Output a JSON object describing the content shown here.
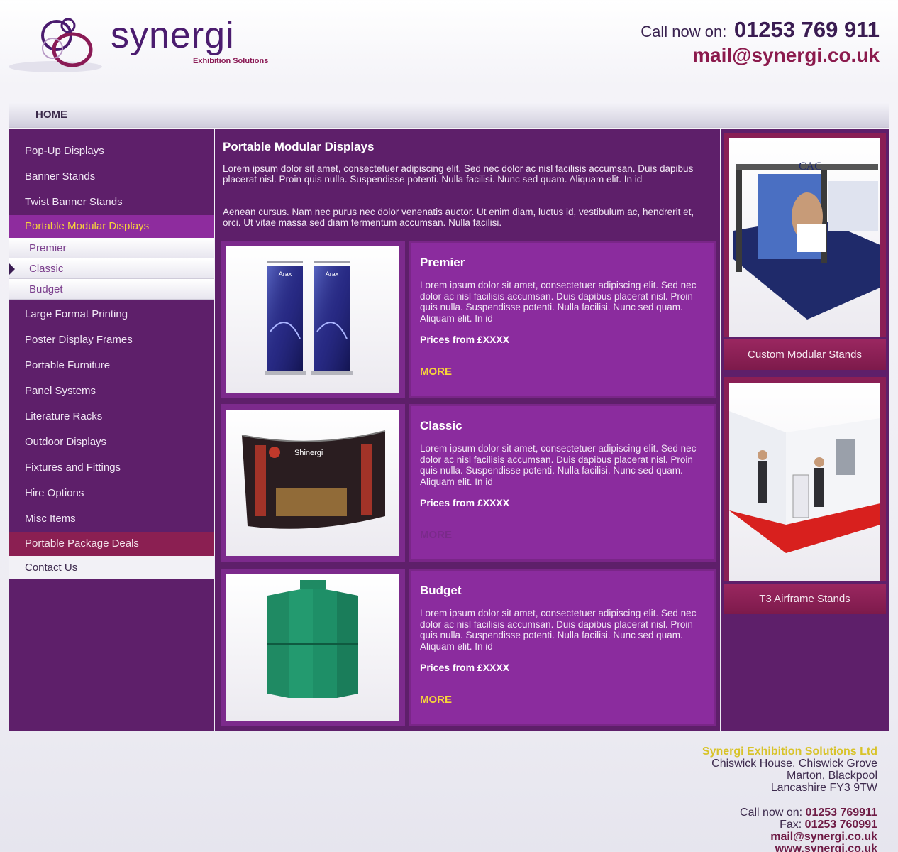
{
  "brand": {
    "logo_text": "synergi",
    "logo_sub": "Exhibition Solutions"
  },
  "header": {
    "call_label": "Call now on:",
    "phone": "01253 769 911",
    "email": "mail@synergi.co.uk"
  },
  "nav": {
    "home": "HOME"
  },
  "sidebar": {
    "items_top": [
      {
        "label": "Pop-Up Displays"
      },
      {
        "label": "Banner Stands"
      },
      {
        "label": "Twist Banner Stands"
      }
    ],
    "active": "Portable Modular Displays",
    "sub_items": [
      {
        "label": "Premier"
      },
      {
        "label": "Classic"
      },
      {
        "label": "Budget"
      }
    ],
    "items_bottom": [
      {
        "label": "Large Format Printing"
      },
      {
        "label": "Poster Display Frames"
      },
      {
        "label": "Portable Furniture"
      },
      {
        "label": "Panel Systems"
      },
      {
        "label": "Literature Racks"
      },
      {
        "label": "Outdoor Displays"
      },
      {
        "label": "Fixtures and Fittings"
      },
      {
        "label": "Hire Options"
      },
      {
        "label": "Misc Items"
      }
    ],
    "package": "Portable Package Deals",
    "contact": "Contact Us"
  },
  "main": {
    "title": "Portable Modular Displays",
    "p1": "Lorem ipsum dolor sit amet, consectetuer adipiscing elit. Sed nec dolor ac nisl facilisis accumsan. Duis dapibus placerat nisl. Proin quis nulla. Suspendisse potenti. Nulla facilisi. Nunc sed quam. Aliquam elit. In id",
    "p2": "Aenean cursus. Nam nec purus nec dolor venenatis auctor. Ut enim diam, luctus id, vestibulum ac, hendrerit et, orci. Ut vitae massa sed diam fermentum accumsan. Nulla facilisi.",
    "products": [
      {
        "title": "Premier",
        "desc": "Lorem ipsum dolor sit amet, consectetuer adipiscing elit. Sed nec dolor ac nisl facilisis accumsan. Duis dapibus placerat nisl. Proin quis nulla. Suspendisse potenti. Nulla facilisi. Nunc sed quam. Aliquam elit. In id",
        "price": "Prices from £XXXX",
        "more": "MORE",
        "image_labels": [
          "Arax",
          "Arax"
        ]
      },
      {
        "title": "Classic",
        "desc": "Lorem ipsum dolor sit amet, consectetuer adipiscing elit. Sed nec dolor ac nisl facilisis accumsan. Duis dapibus placerat nisl. Proin quis nulla. Suspendisse potenti. Nulla facilisi. Nunc sed quam. Aliquam elit. In id",
        "price": "Prices from £XXXX",
        "more": "MORE",
        "image_label": "Shinergi"
      },
      {
        "title": "Budget",
        "desc": "Lorem ipsum dolor sit amet, consectetuer adipiscing elit. Sed nec dolor ac nisl facilisis accumsan. Duis dapibus placerat nisl. Proin quis nulla. Suspendisse potenti. Nulla facilisi. Nunc sed quam. Aliquam elit. In id",
        "price": "Prices from £XXXX",
        "more": "MORE"
      }
    ]
  },
  "right": {
    "features": [
      {
        "label": "Custom Modular Stands",
        "image_label": "CAC"
      },
      {
        "label": "T3 Airframe Stands"
      }
    ]
  },
  "footer": {
    "company": "Synergi Exhibition Solutions Ltd",
    "address": [
      "Chiswick House, Chiswick Grove",
      "Marton, Blackpool",
      "Lancashire FY3 9TW"
    ],
    "call_label": "Call now on:",
    "call_value": "01253 769911",
    "fax_label": "Fax:",
    "fax_value": "01253 760991",
    "email": "mail@synergi.co.uk",
    "web": "www.synergi.co.uk"
  },
  "colors": {
    "purple_dark": "#5e1f6a",
    "purple_mid": "#8b2c9e",
    "magenta": "#8b1f52",
    "highlight_yellow": "#f7d43a"
  }
}
